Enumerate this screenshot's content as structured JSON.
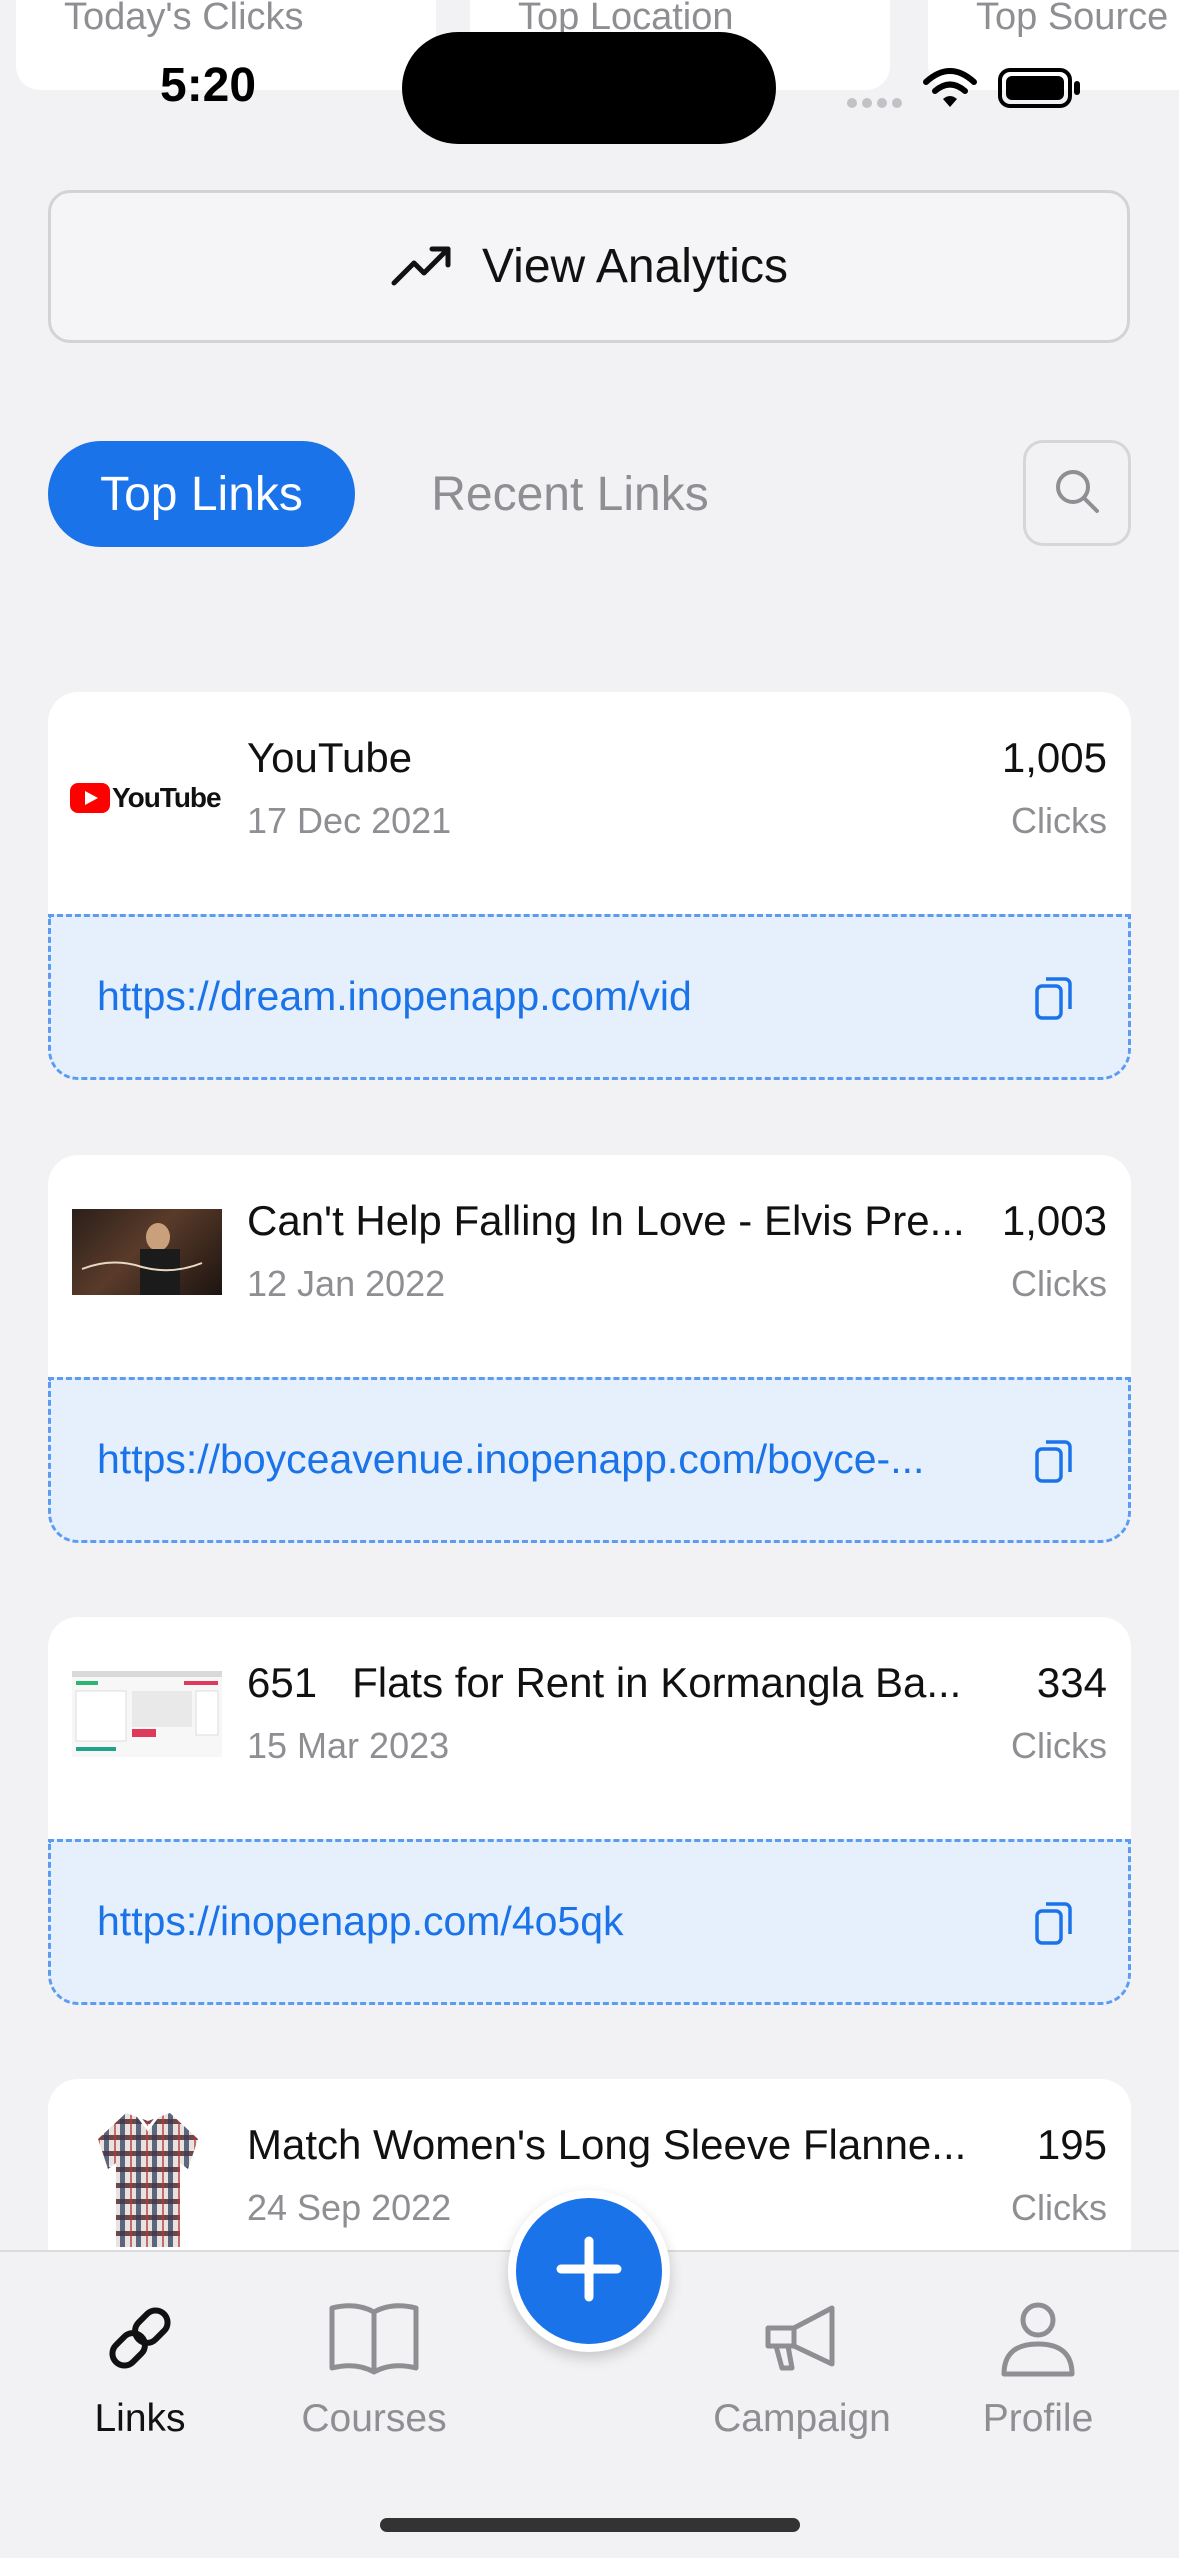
{
  "status_bar": {
    "time": "5:20"
  },
  "stats": [
    {
      "label": "Today's Clicks"
    },
    {
      "label": "Top Location"
    },
    {
      "label": "Top Source"
    }
  ],
  "analytics_button": {
    "label": "View Analytics"
  },
  "tabs": {
    "active": "Top Links",
    "inactive": "Recent Links"
  },
  "links": [
    {
      "title": "YouTube",
      "thumb_text": "YouTube",
      "date": "17 Dec 2021",
      "count": "1,005",
      "clicks_label": "Clicks",
      "url": "https://dream.inopenapp.com/vid"
    },
    {
      "title": "Can't Help Falling In Love - Elvis Pre...",
      "date": "12 Jan 2022",
      "count": "1,003",
      "clicks_label": "Clicks",
      "url": "https://boyceavenue.inopenapp.com/boyce-..."
    },
    {
      "title": "651   Flats for Rent in Kormangla Ba...",
      "date": "15 Mar 2023",
      "count": "334",
      "clicks_label": "Clicks",
      "url": "https://inopenapp.com/4o5qk"
    },
    {
      "title": "Match Women's Long Sleeve Flanne...",
      "date": "24 Sep 2022",
      "count": "195",
      "clicks_label": "Clicks"
    }
  ],
  "nav": [
    {
      "label": "Links",
      "icon": "link-icon"
    },
    {
      "label": "Courses",
      "icon": "book-icon"
    },
    {
      "label": "Campaign",
      "icon": "megaphone-icon"
    },
    {
      "label": "Profile",
      "icon": "person-icon"
    }
  ],
  "colors": {
    "accent": "#1a73e8",
    "background": "#f2f2f4",
    "url_bg": "#e6f0fd"
  }
}
